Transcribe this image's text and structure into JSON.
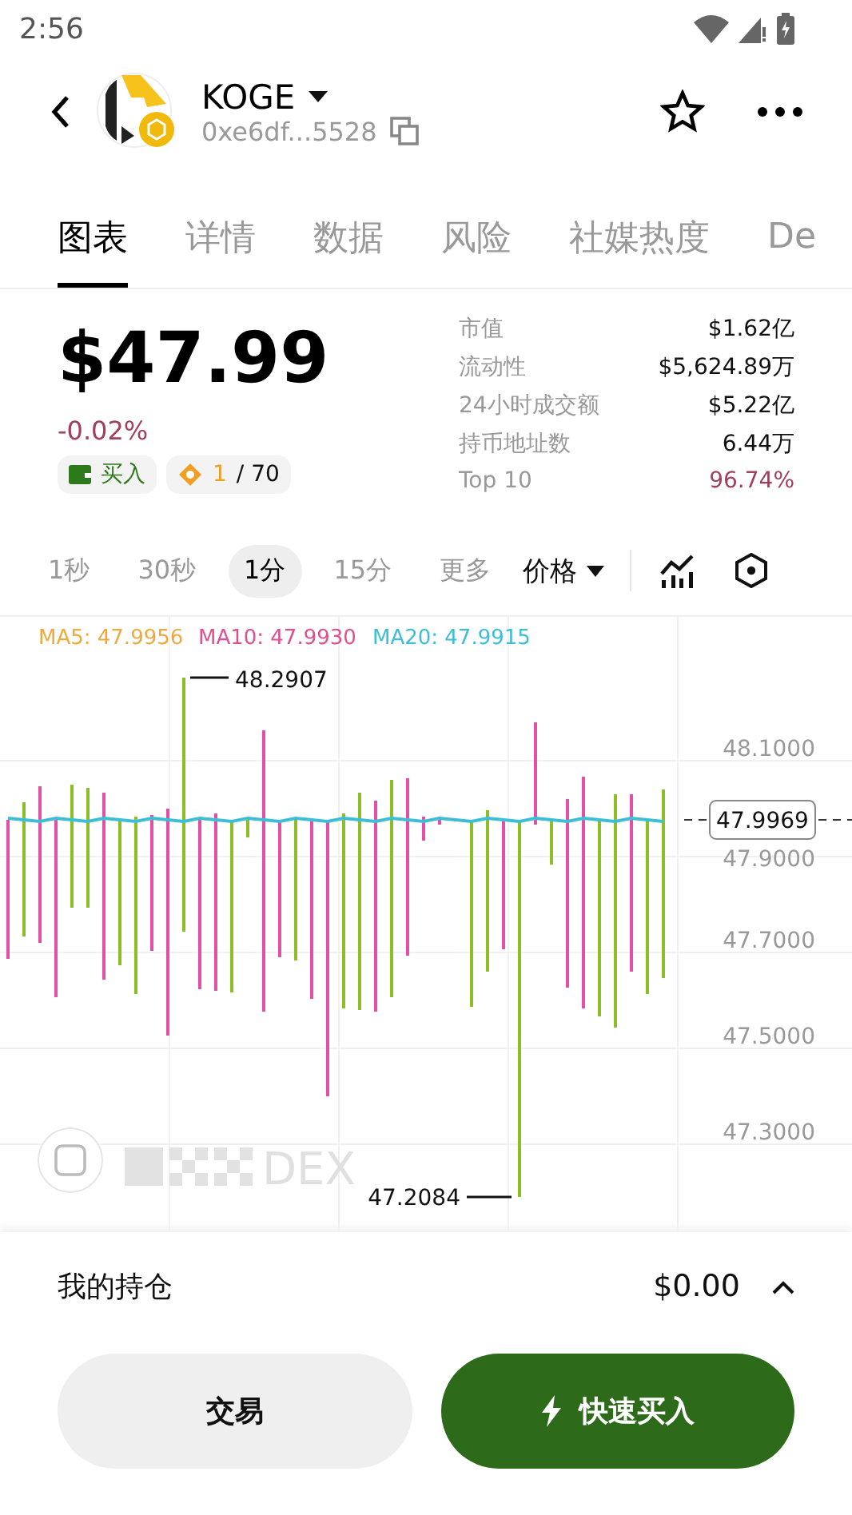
{
  "status_bar": {
    "time": "2:56"
  },
  "header": {
    "symbol": "KOGE",
    "address": "0xe6df...5528"
  },
  "tabs": [
    {
      "label": "图表",
      "selected": true
    },
    {
      "label": "详情",
      "selected": false
    },
    {
      "label": "数据",
      "selected": false
    },
    {
      "label": "风险",
      "selected": false
    },
    {
      "label": "社媒热度",
      "selected": false
    },
    {
      "label": "De",
      "selected": false
    }
  ],
  "price": {
    "value": "$47.99",
    "change": "-0.02%",
    "negative": true
  },
  "badges": {
    "buy": "买入",
    "rank": "1",
    "rank_total": "/ 70"
  },
  "stats": [
    {
      "label": "市值",
      "value": "$1.62亿",
      "highlight": false
    },
    {
      "label": "流动性",
      "value": "$5,624.89万",
      "highlight": false
    },
    {
      "label": "24小时成交额",
      "value": "$5.22亿",
      "highlight": false
    },
    {
      "label": "持币地址数",
      "value": "6.44万",
      "highlight": false
    },
    {
      "label": "Top 10",
      "value": "96.74%",
      "highlight": true
    }
  ],
  "intervals": [
    {
      "label": "1秒",
      "selected": false
    },
    {
      "label": "30秒",
      "selected": false
    },
    {
      "label": "1分",
      "selected": true
    },
    {
      "label": "15分",
      "selected": false
    },
    {
      "label": "更多",
      "selected": false
    }
  ],
  "price_mode": "价格",
  "chart": {
    "legend": [
      {
        "label": "MA5: 47.9956",
        "color": "#f0a93c"
      },
      {
        "label": "MA10: 47.9930",
        "color": "#e0508f"
      },
      {
        "label": "MA20: 47.9915",
        "color": "#3cbfd6"
      }
    ],
    "yticks": [
      "48.1000",
      "47.9000",
      "47.7000",
      "47.5000",
      "47.3000"
    ],
    "high_label": "48.2907",
    "low_label": "47.2084",
    "current": "47.9969",
    "watermark": "DEX"
  },
  "holdings": {
    "label": "我的持仓",
    "value": "$0.00"
  },
  "actions": {
    "trade": "交易",
    "quick_buy": "快速买入"
  }
}
